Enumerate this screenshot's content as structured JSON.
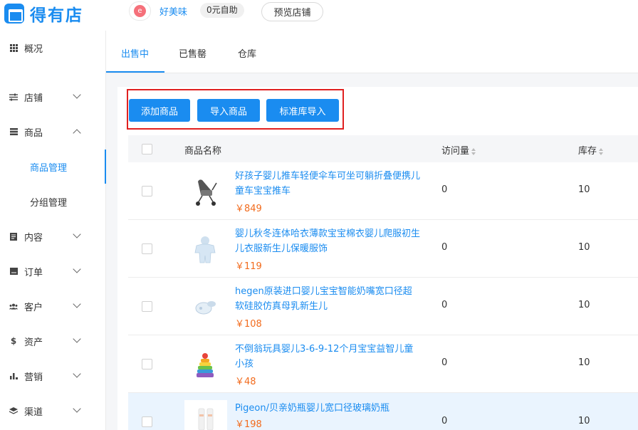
{
  "brand": {
    "name": "得有店",
    "color": "#1a8cf0"
  },
  "shop": {
    "avatar_text": "e",
    "name": "好美味",
    "plan": "0元自助",
    "preview_label": "预览店铺"
  },
  "sidebar": {
    "items": [
      {
        "label": "概况",
        "icon": "grid-icon"
      },
      {
        "label": "店铺",
        "icon": "sliders-icon"
      },
      {
        "label": "商品",
        "icon": "list-icon"
      },
      {
        "label": "内容",
        "icon": "document-icon"
      },
      {
        "label": "订单",
        "icon": "receipt-icon"
      },
      {
        "label": "客户",
        "icon": "users-icon"
      },
      {
        "label": "资产",
        "icon": "dollar-icon"
      },
      {
        "label": "营销",
        "icon": "bar-chart-icon"
      },
      {
        "label": "渠道",
        "icon": "layers-icon"
      }
    ],
    "sub_items": [
      {
        "label": "商品管理",
        "active": true
      },
      {
        "label": "分组管理",
        "active": false
      }
    ]
  },
  "tabs": [
    {
      "label": "出售中",
      "active": true
    },
    {
      "label": "已售罄",
      "active": false
    },
    {
      "label": "仓库",
      "active": false
    }
  ],
  "actions": {
    "add_label": "添加商品",
    "import_label": "导入商品",
    "std_import_label": "标准库导入"
  },
  "table": {
    "headers": {
      "name": "商品名称",
      "visits": "访问量",
      "stock": "库存"
    },
    "rows": [
      {
        "name": "好孩子婴儿推车轻便伞车可坐可躺折叠便携儿童车宝宝推车",
        "price": "￥849",
        "visits": "0",
        "stock": "10"
      },
      {
        "name": "婴儿秋冬连体哈衣薄款宝宝棉衣婴儿爬服初生儿衣服新生儿保暖服饰",
        "price": "￥119",
        "visits": "0",
        "stock": "10"
      },
      {
        "name": "hegen原装进口婴儿宝宝智能奶嘴宽口径超软硅胶仿真母乳新生儿",
        "price": "￥108",
        "visits": "0",
        "stock": "10"
      },
      {
        "name": "不倒翁玩具婴儿3-6-9-12个月宝宝益智儿童小孩",
        "price": "￥48",
        "visits": "0",
        "stock": "10"
      },
      {
        "name": "Pigeon/贝亲奶瓶婴儿宽口径玻璃奶瓶",
        "price": "￥198",
        "visits": "0",
        "stock": "10"
      }
    ]
  },
  "colors": {
    "accent": "#1a8cf0",
    "price": "#f26b1d",
    "highlight_box": "#e02020"
  }
}
